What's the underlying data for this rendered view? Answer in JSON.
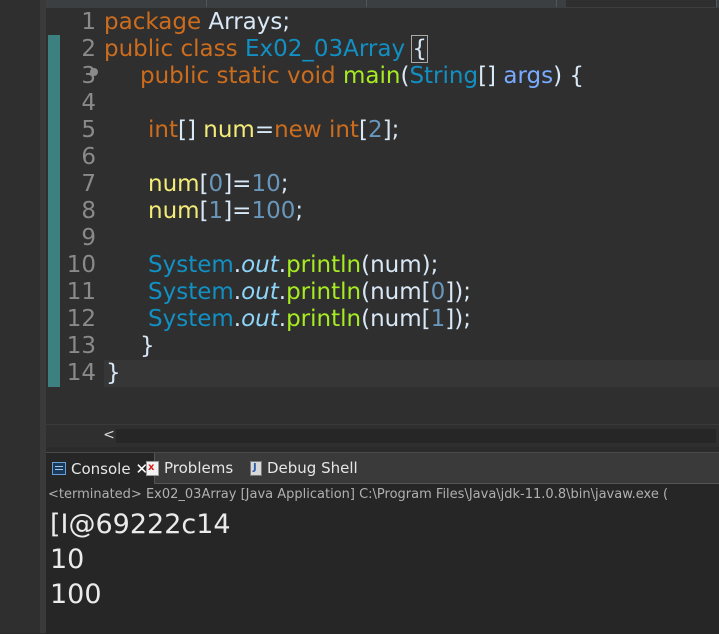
{
  "editor": {
    "line_numbers": [
      "1",
      "2",
      "3",
      "4",
      "5",
      "6",
      "7",
      "8",
      "9",
      "10",
      "11",
      "12",
      "13",
      "14"
    ],
    "code": {
      "l1": {
        "kw": "package",
        "rest": " Arrays;"
      },
      "l2": {
        "kw1": "public",
        "kw2": "class",
        "cls": "Ex02_03Array",
        "brace": "{"
      },
      "l3": {
        "kw1": "public",
        "kw2": "static",
        "kw3": "void",
        "mth": "main",
        "open": "(",
        "type": "String",
        "arr": "[]",
        "param": "args",
        "close": ") {"
      },
      "l5": {
        "kw": "int",
        "arr": "[]",
        "var": "num",
        "eq": "=",
        "new": "new",
        "kw2": "int",
        "lb": "[",
        "num": "2",
        "rb": "];"
      },
      "l7": {
        "var": "num",
        "lb": "[",
        "idx": "0",
        "rb": "]=",
        "val": "10",
        "end": ";"
      },
      "l8": {
        "var": "num",
        "lb": "[",
        "idx": "1",
        "rb": "]=",
        "val": "100",
        "end": ";"
      },
      "l10": {
        "cls": "System",
        "dot": ".",
        "fld": "out",
        "dot2": ".",
        "mth": "println",
        "args": "(num);"
      },
      "l11": {
        "cls": "System",
        "dot": ".",
        "fld": "out",
        "dot2": ".",
        "mth": "println",
        "open": "(num[",
        "idx": "0",
        "close": "]);"
      },
      "l12": {
        "cls": "System",
        "dot": ".",
        "fld": "out",
        "dot2": ".",
        "mth": "println",
        "open": "(num[",
        "idx": "1",
        "close": "]);"
      },
      "l13": {
        "brace": "}"
      },
      "l14": {
        "brace": "}"
      }
    },
    "scroll_left_glyph": "<"
  },
  "console": {
    "tabs": [
      {
        "label": "Console",
        "close": "✕"
      },
      {
        "label": "Problems"
      },
      {
        "label": "Debug Shell"
      }
    ],
    "status": "<terminated> Ex02_03Array [Java Application] C:\\Program Files\\Java\\jdk-11.0.8\\bin\\javaw.exe  (",
    "output": [
      "[I@69222c14",
      "10",
      "100"
    ]
  },
  "colors": {
    "keyword": "#cc6c1d",
    "class": "#1290c3",
    "method": "#a7ec21",
    "variable": "#f3ec79",
    "number": "#6897bb",
    "field_italic": "#8dd6f9",
    "background": "#2f2f2f"
  }
}
